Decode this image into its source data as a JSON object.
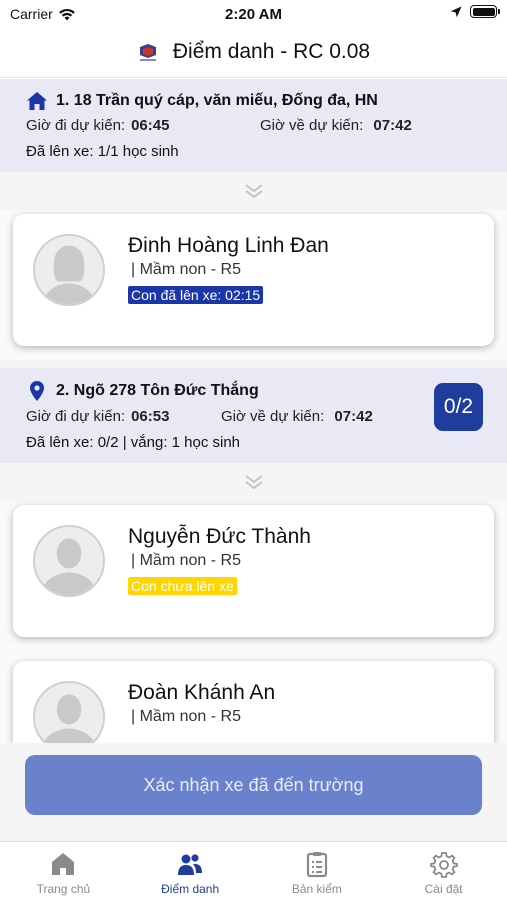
{
  "status_bar": {
    "carrier": "Carrier",
    "time": "2:20 AM",
    "icons": [
      "wifi-icon",
      "location-arrow-icon",
      "battery-icon"
    ]
  },
  "nav": {
    "title": "Điểm danh - RC 0.08",
    "logo": "school-logo-icon"
  },
  "labels": {
    "depart": "Giờ đi dự kiến:",
    "return": "Giờ về dự kiến:"
  },
  "stops": [
    {
      "icon": "home-icon",
      "title": "1. 18 Trần quý cáp, văn miếu, Đống đa, HN",
      "depart_time": "06:45",
      "return_time": "07:42",
      "summary": "Đã lên xe: 1/1 học sinh",
      "badge": "",
      "students": [
        {
          "name": "Đinh Hoàng Linh Đan",
          "class": "| Mầm non - R5",
          "status": "Con đã lên xe: 02:15",
          "status_type": "boarded",
          "avatar": "female"
        }
      ]
    },
    {
      "icon": "location-pin-icon",
      "title": "2. Ngõ 278 Tôn Đức Thắng",
      "depart_time": "06:53",
      "return_time": "07:42",
      "summary": "Đã lên xe: 0/2 | vắng: 1 học sinh",
      "badge": "0/2",
      "students": [
        {
          "name": "Nguyễn Đức Thành",
          "class": "| Mầm non - R5",
          "status": "Con chưa lên xe",
          "status_type": "not_boarded",
          "avatar": "male"
        },
        {
          "name": "Đoàn Khánh An",
          "class": "| Mầm non - R5",
          "status": "",
          "status_type": "",
          "avatar": "male"
        }
      ]
    }
  ],
  "confirm_button": "Xác nhận xe đã đến trường",
  "tabs": [
    {
      "label": "Trang chủ",
      "icon": "home-icon",
      "active": false
    },
    {
      "label": "Điểm danh",
      "icon": "users-icon",
      "active": true
    },
    {
      "label": "Bản kiểm",
      "icon": "clipboard-icon",
      "active": false
    },
    {
      "label": "Cài đặt",
      "icon": "gear-icon",
      "active": false
    }
  ],
  "colors": {
    "primary": "#1f3d9c",
    "stop_header_bg": "#e8e9f5",
    "boarded_chip": "#1a36a8",
    "not_boarded_chip": "#ffd600",
    "confirm_button": "#6a82cc"
  }
}
